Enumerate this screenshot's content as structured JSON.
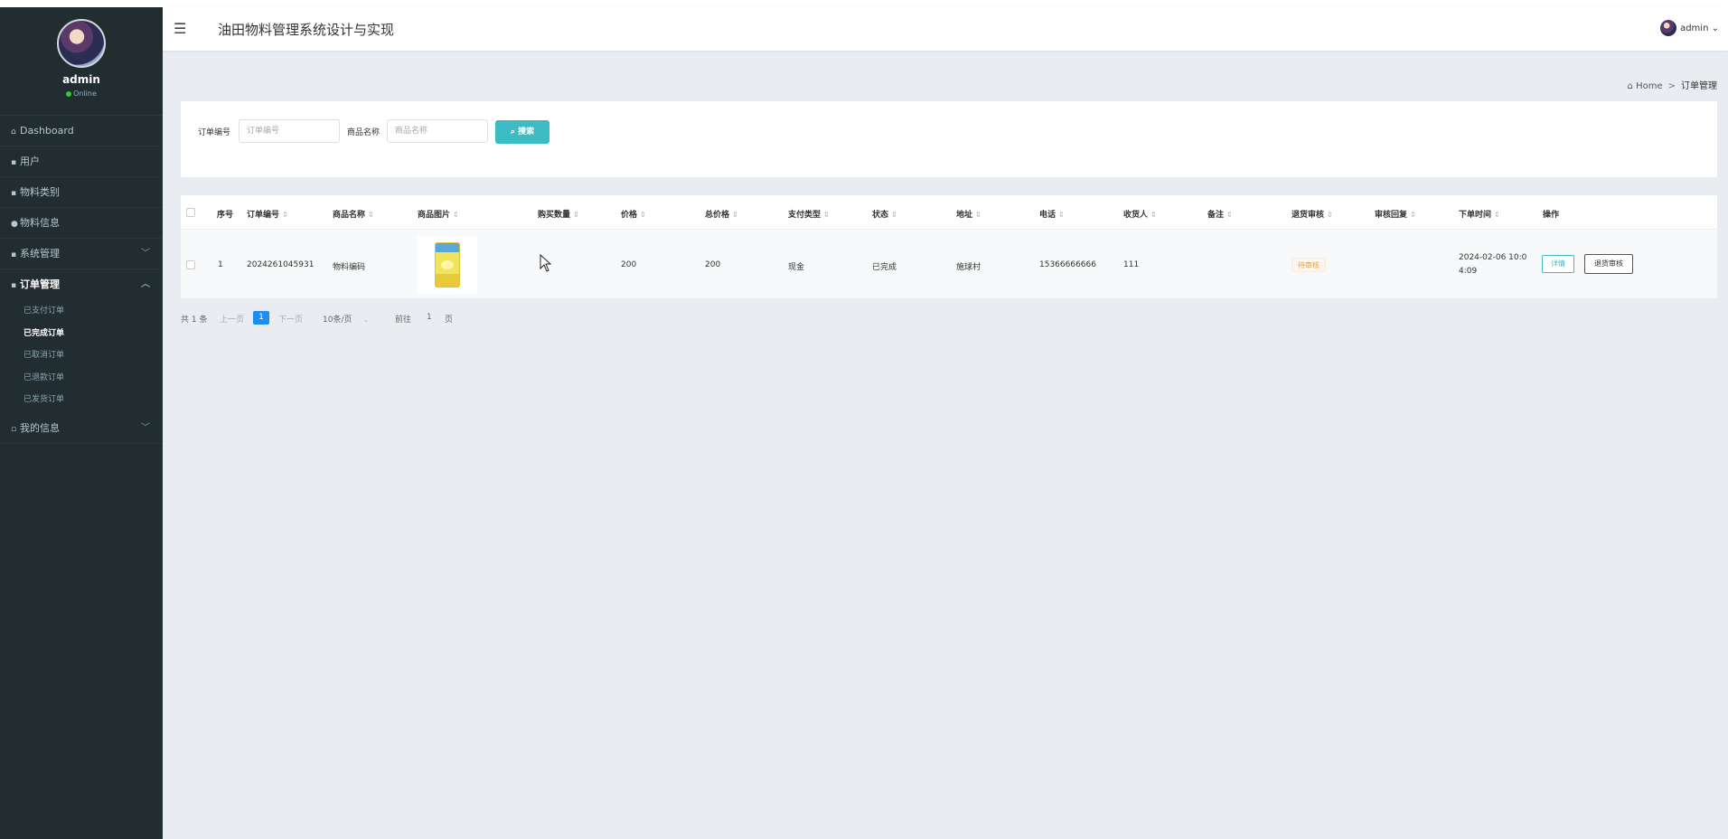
{
  "app": {
    "title": "油田物料管理系统设计与实现",
    "user": "admin"
  },
  "sidebar": {
    "user": {
      "name": "admin",
      "status": "Online"
    },
    "items": [
      {
        "label": "Dashboard",
        "icon": "home-icon"
      },
      {
        "label": "用户",
        "icon": "grid-icon"
      },
      {
        "label": "物料类别",
        "icon": "grid-icon"
      },
      {
        "label": "物料信息",
        "icon": "person-icon"
      },
      {
        "label": "系统管理",
        "icon": "grid-icon"
      },
      {
        "label": "订单管理",
        "icon": "grid-icon"
      },
      {
        "label": "我的信息",
        "icon": "calendar-icon"
      }
    ],
    "order_submenu": [
      "已支付订单",
      "已完成订单",
      "已取消订单",
      "已退款订单",
      "已发货订单"
    ]
  },
  "breadcrumb": {
    "home": "Home",
    "current": "订单管理"
  },
  "search": {
    "order_no_label": "订单编号",
    "order_no_placeholder": "订单编号",
    "product_label": "商品名称",
    "product_placeholder": "商品名称",
    "button": "搜索"
  },
  "table": {
    "columns": [
      "序号",
      "订单编号",
      "商品名称",
      "商品图片",
      "购买数量",
      "价格",
      "总价格",
      "支付类型",
      "状态",
      "地址",
      "电话",
      "收货人",
      "备注",
      "退货审核",
      "审核回复",
      "下单时间",
      "操作"
    ],
    "rows": [
      {
        "index": "1",
        "order_no": "2024261045931",
        "product": "物料编码",
        "quantity": "",
        "price": "200",
        "total": "200",
        "pay_type": "现金",
        "status": "已完成",
        "address": "施球村",
        "phone": "15366666666",
        "receiver": "111",
        "remark": "",
        "return_audit": "待审核",
        "audit_reply": "",
        "time_line1": "2024-02-06 10:0",
        "time_line2": "4:09",
        "actions": [
          "详情",
          "退货审核"
        ]
      }
    ]
  },
  "pagination": {
    "total": "共 1 条",
    "prev": "上一页",
    "current": "1",
    "next": "下一页",
    "page_size": "10条/页",
    "goto_label": "前往",
    "goto_value": "1",
    "goto_suffix": "页"
  },
  "colors": {
    "sidebar_bg": "#222d32",
    "accent": "#3cbcc2",
    "page_active": "#1f8cf0",
    "pending": "#e6a23c"
  }
}
